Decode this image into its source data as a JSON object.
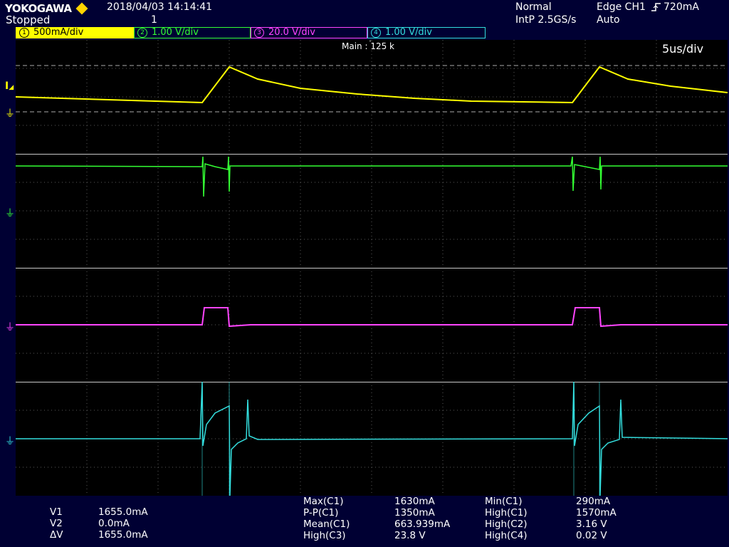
{
  "header": {
    "brand": "YOKOGAWA",
    "status": "Stopped",
    "datetime": "2018/04/03  14:14:41",
    "acq_count": "1",
    "mode": "Normal",
    "sample": "IntP 2.5GS/s",
    "trigger": "Edge CH1",
    "trigger_level": "720mA",
    "trigger_mode": "Auto"
  },
  "channels": [
    {
      "num": "1",
      "scale": "500mA/div",
      "color": "#ffff00",
      "text_color": "#000000",
      "bg": "#ffff00"
    },
    {
      "num": "2",
      "scale": "1.00 V/div",
      "color": "#33ff33",
      "text_color": "#33ff33",
      "bg": "#000033"
    },
    {
      "num": "3",
      "scale": "20.0 V/div",
      "color": "#ff44ff",
      "text_color": "#ff44ff",
      "bg": "#000033"
    },
    {
      "num": "4",
      "scale": "1.00 V/div",
      "color": "#33dddd",
      "text_color": "#33dddd",
      "bg": "#000033"
    }
  ],
  "screen": {
    "main_label": "Main : 125 k",
    "timebase": "5us/div"
  },
  "cursors": {
    "v1_label": "V1",
    "v1_value": "1655.0mA",
    "v2_label": "V2",
    "v2_value": "0.0mA",
    "dv_label": "ΔV",
    "dv_value": "1655.0mA"
  },
  "measurements": [
    {
      "label": "Max(C1)",
      "value": "1630mA"
    },
    {
      "label": "P-P(C1)",
      "value": "1350mA"
    },
    {
      "label": "Mean(C1)",
      "value": "663.939mA"
    },
    {
      "label": "High(C3)",
      "value": "23.8 V"
    },
    {
      "label": "Min(C1)",
      "value": "290mA"
    },
    {
      "label": "High(C1)",
      "value": "1570mA"
    },
    {
      "label": "High(C2)",
      "value": "3.16 V"
    },
    {
      "label": "High(C4)",
      "value": "0.02 V"
    }
  ],
  "colors": {
    "background": "#000033",
    "grid": "#5a5a5a",
    "ch1": "#ffff00",
    "ch2": "#33ff33",
    "ch3": "#ff44ff",
    "ch4": "#33dddd"
  }
}
